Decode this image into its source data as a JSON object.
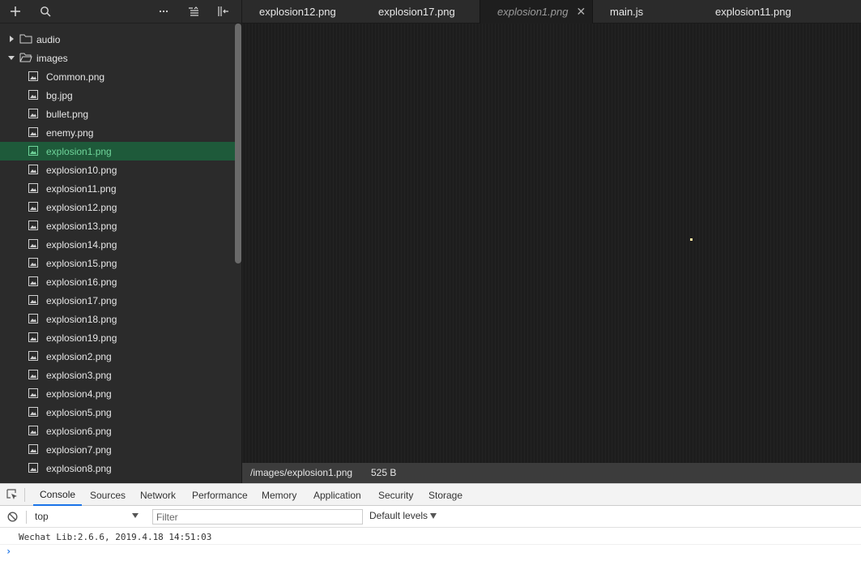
{
  "sidebar": {
    "toolbar": {
      "add_icon": "plus-icon",
      "search_icon": "search-icon",
      "more_icon": "ellipsis-icon",
      "collapse_icon": "collapse-tree-icon",
      "layout_icon": "panel-toggle-icon"
    },
    "folders": [
      {
        "label": "audio",
        "expanded": false
      },
      {
        "label": "images",
        "expanded": true
      }
    ],
    "files": [
      "Common.png",
      "bg.jpg",
      "bullet.png",
      "enemy.png",
      "explosion1.png",
      "explosion10.png",
      "explosion11.png",
      "explosion12.png",
      "explosion13.png",
      "explosion14.png",
      "explosion15.png",
      "explosion16.png",
      "explosion17.png",
      "explosion18.png",
      "explosion19.png",
      "explosion2.png",
      "explosion3.png",
      "explosion4.png",
      "explosion5.png",
      "explosion6.png",
      "explosion7.png",
      "explosion8.png"
    ],
    "selected_file": "explosion1.png"
  },
  "tabs": [
    {
      "label": "explosion12.png",
      "active": false
    },
    {
      "label": "explosion17.png",
      "active": false
    },
    {
      "label": "explosion1.png",
      "active": true
    },
    {
      "label": "main.js",
      "active": false
    },
    {
      "label": "explosion11.png",
      "active": false
    }
  ],
  "tab_close_glyph": "✕",
  "status": {
    "path": "/images/explosion1.png",
    "size": "525 B"
  },
  "devtools": {
    "tabs": [
      "Console",
      "Sources",
      "Network",
      "Performance",
      "Memory",
      "Application",
      "Security",
      "Storage"
    ],
    "active_tab": "Console",
    "context": "top",
    "filter_placeholder": "Filter",
    "levels_label": "Default levels",
    "console_lines": [
      "Wechat Lib:2.6.6, 2019.4.18 14:51:03"
    ],
    "prompt_glyph": "›"
  },
  "colors": {
    "selected_bg": "#1e5a3a",
    "selected_text": "#6fd49a",
    "accent": "#1a73e8"
  }
}
